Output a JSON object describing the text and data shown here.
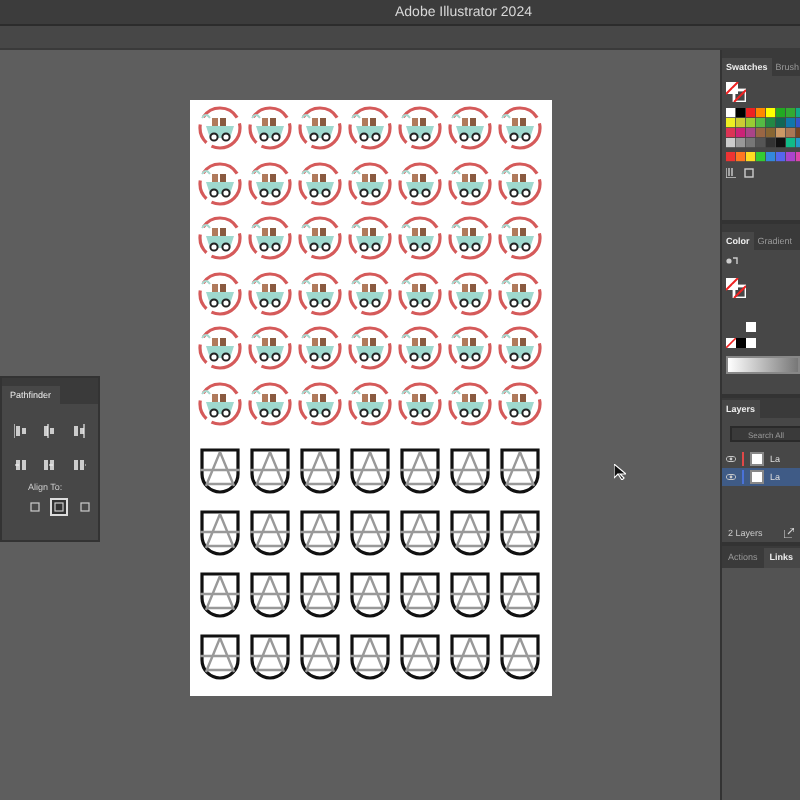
{
  "window": {
    "title": "Adobe Illustrator 2024"
  },
  "panels": {
    "swatches": {
      "tabs": [
        {
          "label": "Swatches",
          "selected": true
        },
        {
          "label": "Brush",
          "selected": false
        }
      ]
    },
    "color": {
      "tabs": [
        {
          "label": "Color",
          "selected": true
        },
        {
          "label": "Gradient",
          "selected": false
        }
      ]
    },
    "layers": {
      "tabs": [
        {
          "label": "Layers",
          "selected": true
        }
      ],
      "search": {
        "placeholder": "Search All"
      },
      "rows": [
        {
          "name": "La",
          "color": "#e04848",
          "selected": false
        },
        {
          "name": "La",
          "color": "#4a72d8",
          "selected": true
        }
      ],
      "count": "2 Layers"
    },
    "bottom_tabs": [
      {
        "label": "Actions",
        "selected": false
      },
      {
        "label": "Links",
        "selected": true
      }
    ]
  },
  "pathfinder": {
    "tabs": [
      {
        "label": "Pathfinder",
        "selected": true
      }
    ],
    "align_to_label": "Align To:",
    "align_to_options": [
      {
        "selected": false
      },
      {
        "selected": true
      },
      {
        "selected": false
      }
    ]
  }
}
